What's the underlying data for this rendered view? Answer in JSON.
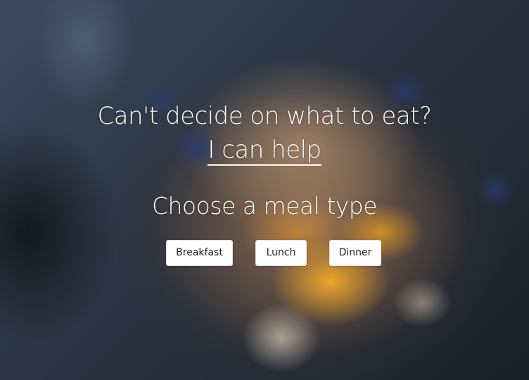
{
  "hero": {
    "title": "Can't decide on what to eat?",
    "help_link": "I can help",
    "subtitle": "Choose a meal type"
  },
  "meal_types": {
    "breakfast_label": "Breakfast",
    "lunch_label": "Lunch",
    "dinner_label": "Dinner"
  },
  "colors": {
    "text": "#ffffff",
    "button_bg": "#ffffff",
    "button_text": "#222222"
  }
}
